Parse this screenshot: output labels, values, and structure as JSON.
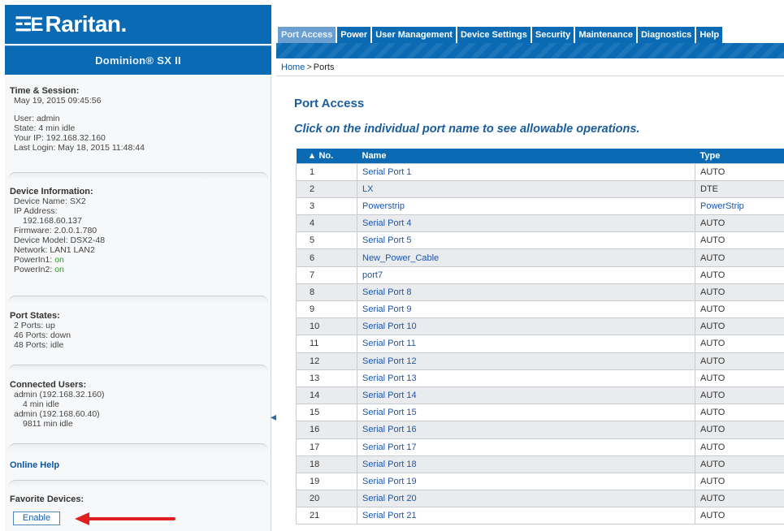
{
  "brand": {
    "logo_glyph": "☲E",
    "logo_text": "Raritan.",
    "product": "Dominion® SX II"
  },
  "colors": {
    "brand_blue": "#0a6bb4",
    "link_blue": "#1f56a8",
    "status_on": "#2b9a2b",
    "arrow_red": "#e02020"
  },
  "tabs": [
    {
      "label": "Port Access",
      "active": true
    },
    {
      "label": "Power",
      "active": false
    },
    {
      "label": "User Management",
      "active": false
    },
    {
      "label": "Device Settings",
      "active": false
    },
    {
      "label": "Security",
      "active": false
    },
    {
      "label": "Maintenance",
      "active": false
    },
    {
      "label": "Diagnostics",
      "active": false
    },
    {
      "label": "Help",
      "active": false
    }
  ],
  "breadcrumb": {
    "home": "Home",
    "sep": ">",
    "current": "Ports"
  },
  "sidebar": {
    "time_session": {
      "title": "Time & Session:",
      "datetime": "May 19, 2015 09:45:56",
      "user": "User: admin",
      "state": "State: 4 min idle",
      "ip": "Your IP: 192.168.32.160",
      "last_login": "Last Login: May 18, 2015 11:48:44"
    },
    "device_info": {
      "title": "Device Information:",
      "name": "Device Name: SX2",
      "ip_label": "IP Address:",
      "ip_value": "192.168.60.137",
      "firmware": "Firmware: 2.0.0.1.780",
      "model": "Device Model: DSX2-48",
      "network": "Network: LAN1 LAN2",
      "powerin1_label": "PowerIn1:",
      "powerin1_value": "on",
      "powerin2_label": "PowerIn2:",
      "powerin2_value": "on"
    },
    "port_states": {
      "title": "Port States:",
      "up": "2 Ports: up",
      "down": "46 Ports: down",
      "idle": "48 Ports: idle"
    },
    "connected_users": {
      "title": "Connected Users:",
      "user1": "admin (192.168.32.160)",
      "user1_idle": "4 min idle",
      "user2": "admin (192.168.60.40)",
      "user2_idle": "9811 min idle"
    },
    "online_help": "Online Help",
    "favorites": {
      "title": "Favorite Devices:",
      "enable_button": "Enable"
    }
  },
  "main": {
    "title": "Port Access",
    "instructions": "Click on the individual port name to see allowable operations.",
    "table": {
      "headers": {
        "no": "▲ No.",
        "name": "Name",
        "type": "Type"
      },
      "rows": [
        {
          "no": "1",
          "name": "Serial Port 1",
          "type": "AUTO"
        },
        {
          "no": "2",
          "name": "LX",
          "type": "DTE"
        },
        {
          "no": "3",
          "name": "Powerstrip",
          "type": "PowerStrip"
        },
        {
          "no": "4",
          "name": "Serial Port 4",
          "type": "AUTO"
        },
        {
          "no": "5",
          "name": "Serial Port 5",
          "type": "AUTO"
        },
        {
          "no": "6",
          "name": "New_Power_Cable",
          "type": "AUTO"
        },
        {
          "no": "7",
          "name": "port7",
          "type": "AUTO"
        },
        {
          "no": "8",
          "name": "Serial Port 8",
          "type": "AUTO"
        },
        {
          "no": "9",
          "name": "Serial Port 9",
          "type": "AUTO"
        },
        {
          "no": "10",
          "name": "Serial Port 10",
          "type": "AUTO"
        },
        {
          "no": "11",
          "name": "Serial Port 11",
          "type": "AUTO"
        },
        {
          "no": "12",
          "name": "Serial Port 12",
          "type": "AUTO"
        },
        {
          "no": "13",
          "name": "Serial Port 13",
          "type": "AUTO"
        },
        {
          "no": "14",
          "name": "Serial Port 14",
          "type": "AUTO"
        },
        {
          "no": "15",
          "name": "Serial Port 15",
          "type": "AUTO"
        },
        {
          "no": "16",
          "name": "Serial Port 16",
          "type": "AUTO"
        },
        {
          "no": "17",
          "name": "Serial Port 17",
          "type": "AUTO"
        },
        {
          "no": "18",
          "name": "Serial Port 18",
          "type": "AUTO"
        },
        {
          "no": "19",
          "name": "Serial Port 19",
          "type": "AUTO"
        },
        {
          "no": "20",
          "name": "Serial Port 20",
          "type": "AUTO"
        },
        {
          "no": "21",
          "name": "Serial Port 21",
          "type": "AUTO"
        }
      ]
    }
  }
}
